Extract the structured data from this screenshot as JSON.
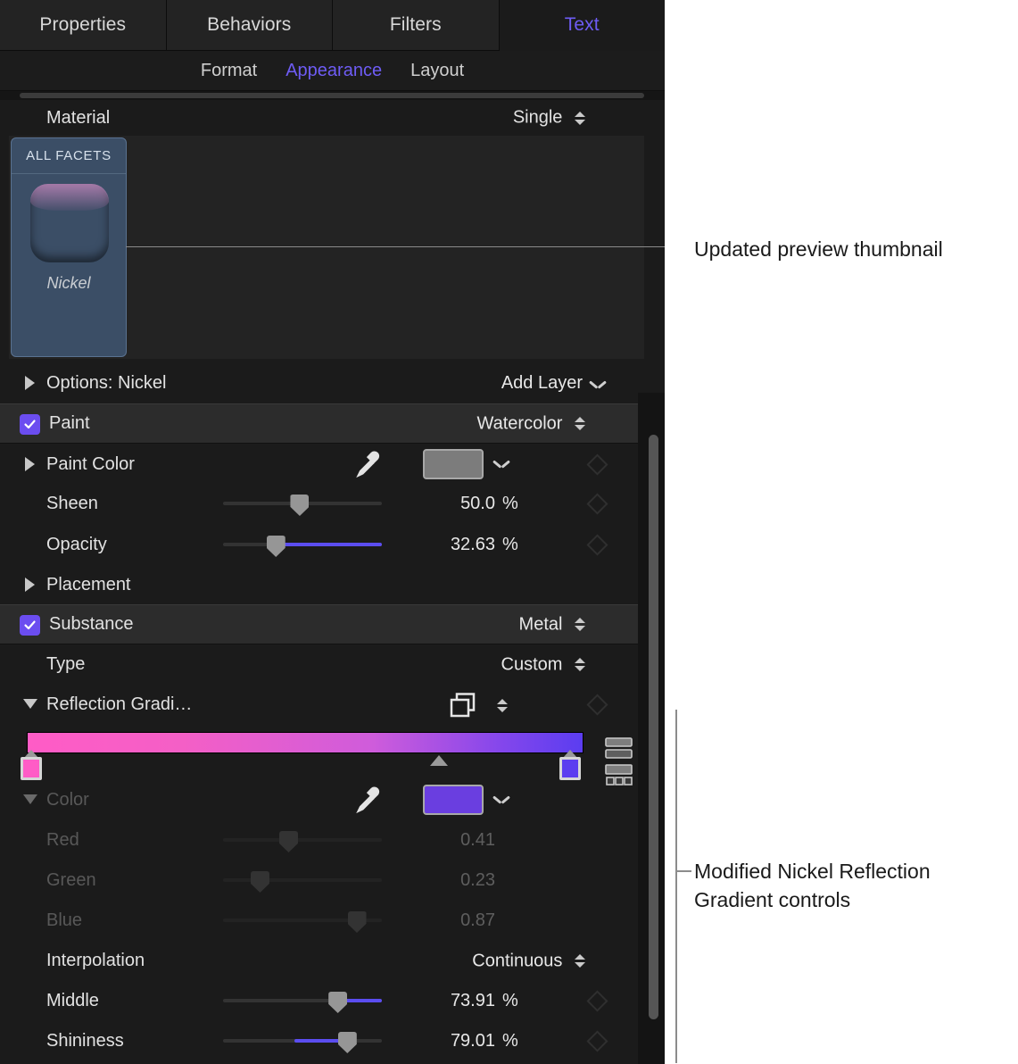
{
  "tabs": [
    {
      "label": "Properties",
      "selected": false
    },
    {
      "label": "Behaviors",
      "selected": false
    },
    {
      "label": "Filters",
      "selected": false
    },
    {
      "label": "Text",
      "selected": true
    }
  ],
  "subtabs": [
    {
      "label": "Format",
      "selected": false
    },
    {
      "label": "Appearance",
      "selected": true
    },
    {
      "label": "Layout",
      "selected": false
    }
  ],
  "material": {
    "label": "Material",
    "value": "Single",
    "facet_title": "ALL FACETS",
    "facet_name": "Nickel"
  },
  "options": {
    "label": "Options: Nickel",
    "add_layer_label": "Add Layer"
  },
  "paint": {
    "label": "Paint",
    "value": "Watercolor",
    "checked": true,
    "color_label": "Paint Color",
    "color_swatch": "#7c7c7c",
    "sheen_label": "Sheen",
    "sheen_value": "50.0",
    "sheen_unit": "%",
    "sheen_pct": 48,
    "opacity_label": "Opacity",
    "opacity_value": "32.63",
    "opacity_unit": "%",
    "opacity_pct": 33,
    "placement_label": "Placement"
  },
  "substance": {
    "label": "Substance",
    "value": "Metal",
    "checked": true,
    "type_label": "Type",
    "type_value": "Custom",
    "gradient_label": "Reflection Gradi…",
    "color_label": "Color",
    "color_swatch": "#6a3ee0",
    "red_label": "Red",
    "red_value": "0.41",
    "red_pct": 41,
    "green_label": "Green",
    "green_value": "0.23",
    "green_pct": 23,
    "blue_label": "Blue",
    "blue_value": "0.87",
    "blue_pct": 87,
    "interpolation_label": "Interpolation",
    "interpolation_value": "Continuous",
    "middle_label": "Middle",
    "middle_value": "73.91",
    "middle_unit": "%",
    "middle_pct": 73.91,
    "shininess_label": "Shininess",
    "shininess_value": "79.01",
    "shininess_unit": "%",
    "shininess_pct": 79.01
  },
  "gradient": {
    "start_color": "#ff5cc6",
    "end_color": "#5b3df0",
    "mid_position_pct": 74,
    "css": "linear-gradient(90deg, #ff5cc6 0%, #f45fc6 28%, #cf5cdb 62%, #8246ec 86%, #5b3df0 100%)"
  },
  "annotations": [
    {
      "text": "Updated preview thumbnail"
    },
    {
      "text": "Modified Nickel Reflection Gradient controls"
    }
  ],
  "annotation_lines": {
    "line2_a": "Modified Nickel Reflection",
    "line2_b": "Gradient controls"
  },
  "accent": "#6b4df0"
}
